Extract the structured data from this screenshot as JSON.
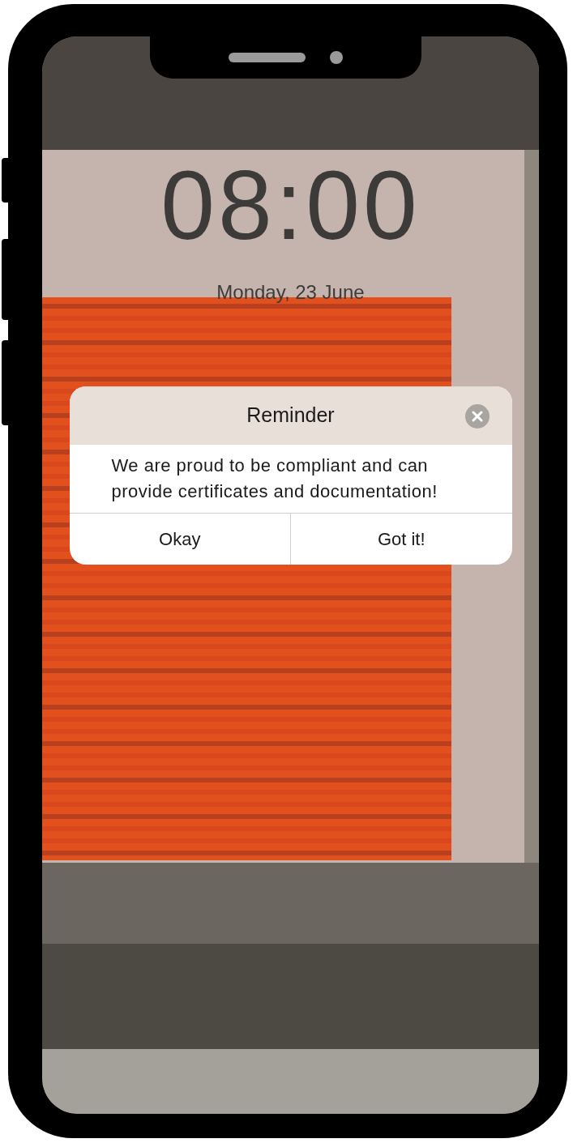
{
  "lock_screen": {
    "time": "08:00",
    "date": "Monday, 23 June"
  },
  "dialog": {
    "title": "Reminder",
    "message": "We are proud to be compliant and can provide certificates and documentation!",
    "buttons": [
      "Okay",
      "Got it!"
    ]
  }
}
